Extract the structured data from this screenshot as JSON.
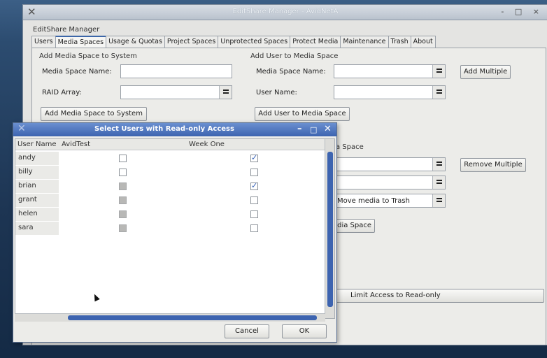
{
  "main_window": {
    "title": "EditShare Manager - AvidNetA",
    "app_label": "EditShare Manager",
    "controls": "- □ ×",
    "tabs": [
      "Users",
      "Media Spaces",
      "Usage & Quotas",
      "Project Spaces",
      "Unprotected Spaces",
      "Protect Media",
      "Maintenance",
      "Trash",
      "About"
    ],
    "active_tab": "Media Spaces"
  },
  "add_media_space": {
    "group_title": "Add Media Space to System",
    "name_label": "Media Space Name:",
    "name_value": "",
    "raid_label": "RAID Array:",
    "raid_value": "",
    "add_button": "Add Media Space to System"
  },
  "add_user": {
    "group_title": "Add User to Media Space",
    "space_label": "Media Space Name:",
    "space_value": "",
    "user_label": "User Name:",
    "user_value": "",
    "add_multiple_button": "Add Multiple",
    "add_button": "Add User to Media Space"
  },
  "remove_section": {
    "group_title_fragment": "a Space",
    "remove_multiple_button": "Remove Multiple",
    "move_media_value": "Move media to Trash",
    "action_button_fragment": "dia Space",
    "limit_button": "Limit Access to Read-only"
  },
  "dialog": {
    "title": "Select Users with Read-only Access",
    "columns": [
      "User Name",
      "AvidTest",
      "Week One"
    ],
    "rows": [
      {
        "user": "andy",
        "avidtest": false,
        "avidtest_disabled": false,
        "weekone": true
      },
      {
        "user": "billy",
        "avidtest": false,
        "avidtest_disabled": false,
        "weekone": false
      },
      {
        "user": "brian",
        "avidtest": false,
        "avidtest_disabled": true,
        "weekone": true
      },
      {
        "user": "grant",
        "avidtest": false,
        "avidtest_disabled": true,
        "weekone": false
      },
      {
        "user": "helen",
        "avidtest": false,
        "avidtest_disabled": true,
        "weekone": false
      },
      {
        "user": "sara",
        "avidtest": false,
        "avidtest_disabled": true,
        "weekone": false
      }
    ],
    "cancel_button": "Cancel",
    "ok_button": "OK"
  },
  "colors": {
    "desktop": "#1d3553",
    "dialog_titlebar": "#3d64b0",
    "scroll_thumb": "#3d64b0",
    "check": "#2a58b4"
  }
}
